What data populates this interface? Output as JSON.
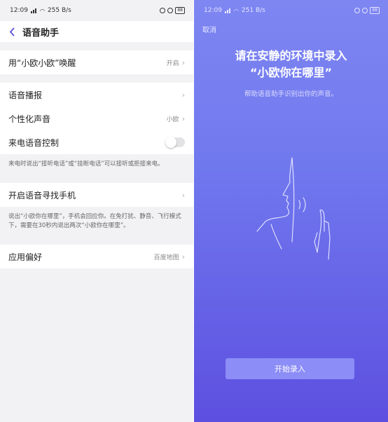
{
  "left": {
    "status": {
      "time": "12:09",
      "speed": "255 B/s",
      "battery": "88"
    },
    "header": {
      "title": "语音助手"
    },
    "wake": {
      "label": "用“小欧小欧”唤醒",
      "value": "开启"
    },
    "broadcast": {
      "label": "语音播报"
    },
    "voice": {
      "label": "个性化声音",
      "value": "小欧"
    },
    "call_control": {
      "label": "来电语音控制",
      "enabled": false,
      "note": "来电时说出“接听电话”或“挂断电话”可以接听或拒接来电。"
    },
    "find_phone": {
      "label": "开启语音寻找手机",
      "note": "说出“小欧你在哪里”，手机会回应你。在免打扰、静音、飞行模式下，需要在30秒内说出两次“小欧你在哪里”。"
    },
    "preference": {
      "label": "应用偏好",
      "value": "百度地图"
    }
  },
  "right": {
    "status": {
      "time": "12:09",
      "speed": "251 B/s",
      "battery": "88"
    },
    "cancel": "取消",
    "title_line1": "请在安静的环境中录入",
    "title_line2": "“小欧你在哪里”",
    "subtitle": "帮助语音助手识别出你的声音。",
    "start_button": "开始录入"
  },
  "colors": {
    "accent": "#5b4fd9",
    "gradient_top": "#7e86f2",
    "gradient_bottom": "#5d4fe0",
    "button": "#8c8df6"
  }
}
